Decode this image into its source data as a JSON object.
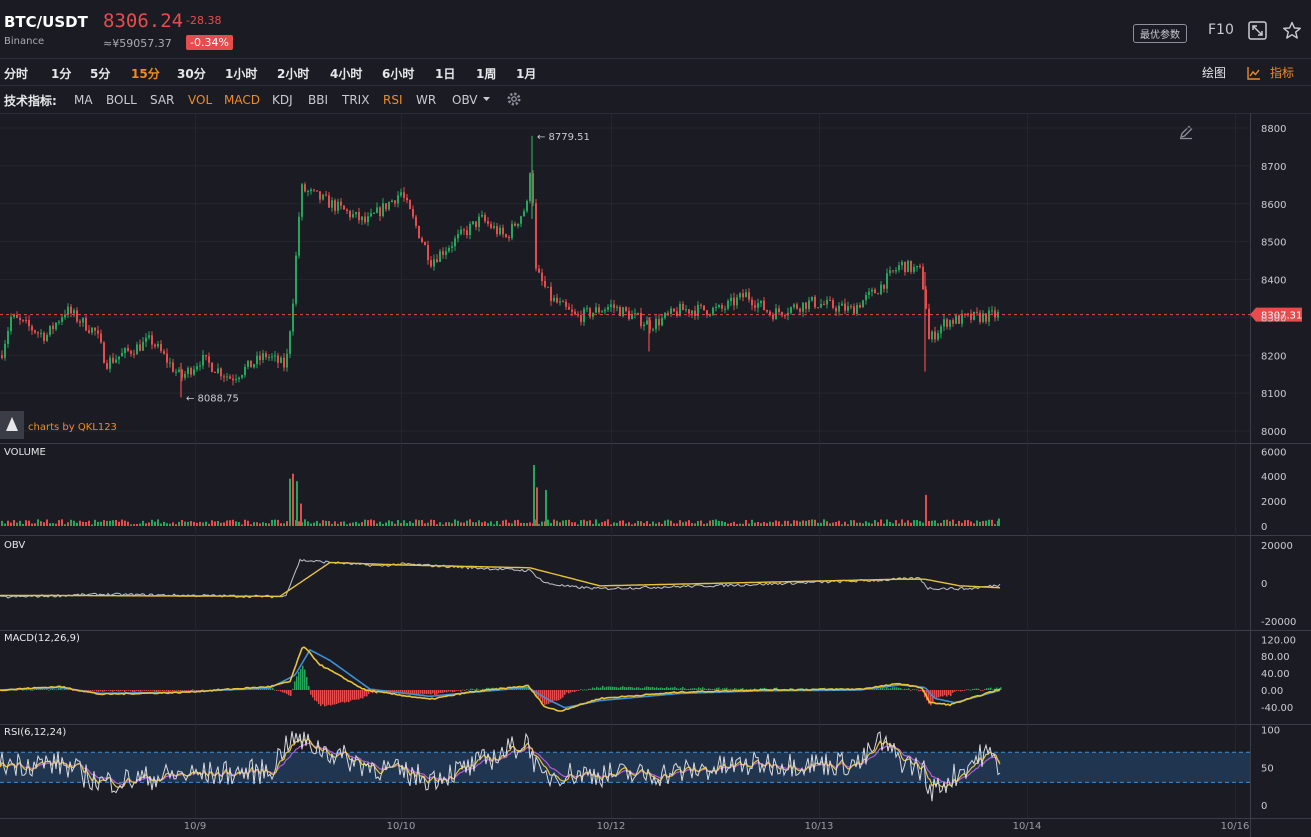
{
  "header": {
    "pair": "BTC/USDT",
    "exchange": "Binance",
    "price": "8306.24",
    "change": "-28.38",
    "cny_price": "≈¥59057.37",
    "change_pct": "-0.34%",
    "params_label": "最优参数",
    "f10_label": "F10"
  },
  "intervals": [
    {
      "label": "分时",
      "active": false
    },
    {
      "label": "1分",
      "active": false
    },
    {
      "label": "5分",
      "active": false
    },
    {
      "label": "15分",
      "active": true
    },
    {
      "label": "30分",
      "active": false
    },
    {
      "label": "1小时",
      "active": false
    },
    {
      "label": "2小时",
      "active": false
    },
    {
      "label": "4小时",
      "active": false
    },
    {
      "label": "6小时",
      "active": false
    },
    {
      "label": "1日",
      "active": false
    },
    {
      "label": "1周",
      "active": false
    },
    {
      "label": "1月",
      "active": false
    }
  ],
  "toolbar_right": {
    "draw_label": "绘图",
    "indicator_label": "指标"
  },
  "indicators": {
    "label": "技术指标:",
    "items": [
      {
        "label": "MA",
        "active": false
      },
      {
        "label": "BOLL",
        "active": false
      },
      {
        "label": "SAR",
        "active": false
      },
      {
        "label": "VOL",
        "active": true
      },
      {
        "label": "MACD",
        "active": true
      },
      {
        "label": "KDJ",
        "active": false
      },
      {
        "label": "BBI",
        "active": false
      },
      {
        "label": "TRIX",
        "active": false
      },
      {
        "label": "RSI",
        "active": true
      },
      {
        "label": "WR",
        "active": false
      },
      {
        "label": "OBV",
        "active": false
      }
    ]
  },
  "colors": {
    "up": "#26a65b",
    "down": "#e74c4c",
    "accent": "#f08a24",
    "bg": "#1b1c23",
    "yellow": "#e8c33a",
    "blue": "#3d8fd6",
    "gray_line": "#c0c2c8"
  },
  "chart_data": [
    {
      "type": "candlestick",
      "series_key": "price",
      "x_ticks": [
        "10/9",
        "10/10",
        "10/12",
        "10/13",
        "10/14",
        "10/16"
      ],
      "y_ticks": [
        8000,
        8100,
        8200,
        8300,
        8400,
        8500,
        8600,
        8700,
        8800
      ],
      "ylim": [
        7970,
        8830
      ],
      "high_marker": "8779.51",
      "low_marker": "8088.75",
      "last_price_tag": "8307.31",
      "last_price": 8307.31,
      "watermark": "charts by QKL123",
      "anchors": [
        [
          0,
          8200
        ],
        [
          10,
          8300
        ],
        [
          45,
          8250
        ],
        [
          65,
          8320
        ],
        [
          95,
          8260
        ],
        [
          105,
          8180
        ],
        [
          150,
          8240
        ],
        [
          180,
          8140
        ],
        [
          200,
          8190
        ],
        [
          230,
          8140
        ],
        [
          265,
          8200
        ],
        [
          285,
          8170
        ],
        [
          292,
          8350
        ],
        [
          300,
          8640
        ],
        [
          330,
          8600
        ],
        [
          365,
          8550
        ],
        [
          400,
          8630
        ],
        [
          430,
          8450
        ],
        [
          480,
          8560
        ],
        [
          505,
          8510
        ],
        [
          527,
          8600
        ],
        [
          530,
          8740
        ],
        [
          535,
          8420
        ],
        [
          550,
          8350
        ],
        [
          575,
          8300
        ],
        [
          610,
          8330
        ],
        [
          650,
          8280
        ],
        [
          680,
          8320
        ],
        [
          720,
          8320
        ],
        [
          745,
          8360
        ],
        [
          770,
          8310
        ],
        [
          810,
          8340
        ],
        [
          850,
          8320
        ],
        [
          875,
          8370
        ],
        [
          900,
          8440
        ],
        [
          920,
          8420
        ],
        [
          925,
          8330
        ],
        [
          928,
          8240
        ],
        [
          945,
          8290
        ],
        [
          975,
          8300
        ],
        [
          1000,
          8307
        ]
      ]
    },
    {
      "type": "bar",
      "title": "VOLUME",
      "y_ticks": [
        0,
        2000,
        4000,
        6000
      ],
      "ylim": [
        0,
        6000
      ],
      "spikes": [
        [
          289,
          3800
        ],
        [
          292,
          4200
        ],
        [
          296,
          3600
        ],
        [
          300,
          1800
        ],
        [
          533,
          4900
        ],
        [
          536,
          3100
        ],
        [
          545,
          2900
        ],
        [
          925,
          2500
        ],
        [
          998,
          600
        ]
      ]
    },
    {
      "type": "line",
      "title": "OBV",
      "y_ticks": [
        20000,
        0,
        -20000
      ],
      "ylim": [
        -21000,
        21000
      ],
      "obv_anchors": [
        [
          0,
          -7500
        ],
        [
          100,
          -6000
        ],
        [
          285,
          -7200
        ],
        [
          300,
          12000
        ],
        [
          340,
          10500
        ],
        [
          380,
          9000
        ],
        [
          400,
          10000
        ],
        [
          530,
          6500
        ],
        [
          545,
          0
        ],
        [
          570,
          -2000
        ],
        [
          600,
          -3000
        ],
        [
          740,
          -1000
        ],
        [
          880,
          1500
        ],
        [
          920,
          2500
        ],
        [
          928,
          -2800
        ],
        [
          970,
          -3000
        ],
        [
          1000,
          -1000
        ]
      ],
      "ma_anchors": [
        [
          0,
          -6500
        ],
        [
          280,
          -7000
        ],
        [
          330,
          10800
        ],
        [
          400,
          9500
        ],
        [
          530,
          8000
        ],
        [
          600,
          -1500
        ],
        [
          900,
          2000
        ],
        [
          925,
          2000
        ],
        [
          960,
          -1500
        ],
        [
          1000,
          -2500
        ]
      ]
    },
    {
      "type": "line",
      "title": "MACD(12,26,9)",
      "y_ticks": [
        "120.00",
        "80.00",
        "40.00",
        "0.00",
        "-40.00"
      ],
      "ylim": [
        -55,
        135
      ],
      "dif_anchors": [
        [
          0,
          0
        ],
        [
          60,
          8
        ],
        [
          100,
          -10
        ],
        [
          180,
          -6
        ],
        [
          270,
          8
        ],
        [
          290,
          20
        ],
        [
          303,
          105
        ],
        [
          320,
          60
        ],
        [
          365,
          0
        ],
        [
          430,
          -22
        ],
        [
          470,
          -5
        ],
        [
          528,
          10
        ],
        [
          545,
          -40
        ],
        [
          560,
          -50
        ],
        [
          600,
          -20
        ],
        [
          680,
          -5
        ],
        [
          760,
          0
        ],
        [
          860,
          2
        ],
        [
          900,
          15
        ],
        [
          922,
          5
        ],
        [
          930,
          -30
        ],
        [
          950,
          -35
        ],
        [
          1000,
          2
        ]
      ],
      "dea_anchors": [
        [
          0,
          0
        ],
        [
          60,
          6
        ],
        [
          100,
          -8
        ],
        [
          180,
          -5
        ],
        [
          270,
          5
        ],
        [
          295,
          35
        ],
        [
          310,
          95
        ],
        [
          330,
          70
        ],
        [
          370,
          2
        ],
        [
          430,
          -15
        ],
        [
          470,
          -6
        ],
        [
          528,
          6
        ],
        [
          550,
          -25
        ],
        [
          565,
          -42
        ],
        [
          600,
          -25
        ],
        [
          680,
          -8
        ],
        [
          760,
          -2
        ],
        [
          860,
          0
        ],
        [
          900,
          12
        ],
        [
          925,
          6
        ],
        [
          935,
          -20
        ],
        [
          955,
          -30
        ],
        [
          1000,
          -1
        ]
      ]
    },
    {
      "type": "line",
      "title": "RSI(6,12,24)",
      "y_ticks": [
        100,
        50,
        0
      ],
      "ylim": [
        0,
        100
      ],
      "band": [
        30,
        70
      ],
      "rsi_anchors": [
        [
          0,
          55
        ],
        [
          60,
          55
        ],
        [
          100,
          30
        ],
        [
          180,
          40
        ],
        [
          270,
          45
        ],
        [
          290,
          90
        ],
        [
          310,
          80
        ],
        [
          360,
          55
        ],
        [
          430,
          35
        ],
        [
          470,
          50
        ],
        [
          528,
          85
        ],
        [
          540,
          35
        ],
        [
          560,
          42
        ],
        [
          650,
          40
        ],
        [
          760,
          55
        ],
        [
          860,
          55
        ],
        [
          880,
          85
        ],
        [
          900,
          60
        ],
        [
          925,
          45
        ],
        [
          928,
          15
        ],
        [
          950,
          35
        ],
        [
          985,
          70
        ],
        [
          1000,
          52
        ]
      ]
    }
  ]
}
